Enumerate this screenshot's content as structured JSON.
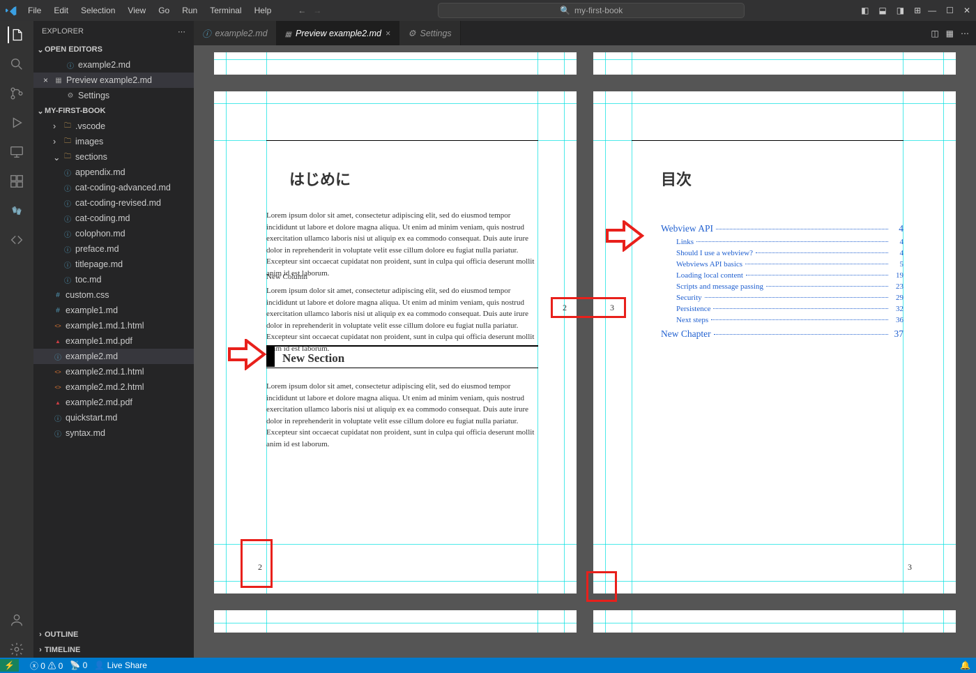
{
  "title": "my-first-book",
  "menu": [
    "File",
    "Edit",
    "Selection",
    "View",
    "Go",
    "Run",
    "Terminal",
    "Help"
  ],
  "sidebar": {
    "title": "EXPLORER",
    "open_editors_label": "OPEN EDITORS",
    "open_editors": [
      {
        "icon": "info",
        "label": "example2.md"
      },
      {
        "icon": "prev",
        "label": "Preview example2.md",
        "closable": true
      },
      {
        "icon": "gear",
        "label": "Settings"
      }
    ],
    "project_label": "MY-FIRST-BOOK",
    "tree": [
      {
        "icon": "folder",
        "label": ".vscode",
        "depth": 1,
        "chev": ">"
      },
      {
        "icon": "folder",
        "label": "images",
        "depth": 1,
        "chev": ">"
      },
      {
        "icon": "folder",
        "label": "sections",
        "depth": 1,
        "chev": "v"
      },
      {
        "icon": "info",
        "label": "appendix.md",
        "depth": 2
      },
      {
        "icon": "info",
        "label": "cat-coding-advanced.md",
        "depth": 2
      },
      {
        "icon": "info",
        "label": "cat-coding-revised.md",
        "depth": 2
      },
      {
        "icon": "info",
        "label": "cat-coding.md",
        "depth": 2
      },
      {
        "icon": "info",
        "label": "colophon.md",
        "depth": 2
      },
      {
        "icon": "info",
        "label": "preface.md",
        "depth": 2
      },
      {
        "icon": "info",
        "label": "titlepage.md",
        "depth": 2
      },
      {
        "icon": "info",
        "label": "toc.md",
        "depth": 2
      },
      {
        "icon": "css",
        "label": "custom.css",
        "depth": 1
      },
      {
        "icon": "md",
        "label": "example1.md",
        "depth": 1
      },
      {
        "icon": "html",
        "label": "example1.md.1.html",
        "depth": 1
      },
      {
        "icon": "pdf",
        "label": "example1.md.pdf",
        "depth": 1
      },
      {
        "icon": "info",
        "label": "example2.md",
        "depth": 1,
        "selected": true
      },
      {
        "icon": "html",
        "label": "example2.md.1.html",
        "depth": 1
      },
      {
        "icon": "html",
        "label": "example2.md.2.html",
        "depth": 1
      },
      {
        "icon": "pdf",
        "label": "example2.md.pdf",
        "depth": 1
      },
      {
        "icon": "info",
        "label": "quickstart.md",
        "depth": 1
      },
      {
        "icon": "info",
        "label": "syntax.md",
        "depth": 1
      }
    ],
    "outline_label": "OUTLINE",
    "timeline_label": "TIMELINE"
  },
  "tabs": [
    {
      "icon": "info",
      "label": "example2.md",
      "active": false
    },
    {
      "icon": "prev",
      "label": "Preview example2.md",
      "active": true,
      "close": true
    },
    {
      "icon": "gear",
      "label": "Settings",
      "active": false
    }
  ],
  "page_left": {
    "h1": "はじめに",
    "para1": "Lorem ipsum dolor sit amet, consectetur adipiscing elit, sed do eiusmod tempor incididunt ut labore et dolore magna aliqua. Ut enim ad minim veniam, quis nostrud exercitation ullamco laboris nisi ut aliquip ex ea commodo consequat. Duis aute irure dolor in reprehenderit in voluptate velit esse cillum dolore eu fugiat nulla pariatur. Excepteur sint occaecat cupidatat non proident, sunt in culpa qui officia deserunt mollit anim id est laborum.",
    "newcol": "New Column",
    "para2": "Lorem ipsum dolor sit amet, consectetur adipiscing elit, sed do eiusmod tempor incididunt ut labore et dolore magna aliqua. Ut enim ad minim veniam, quis nostrud exercitation ullamco laboris nisi ut aliquip ex ea commodo consequat. Duis aute irure dolor in reprehenderit in voluptate velit esse cillum dolore eu fugiat nulla pariatur. Excepteur sint occaecat cupidatat non proident, sunt in culpa qui officia deserunt mollit anim id est laborum.",
    "section": "New Section",
    "para3": "Lorem ipsum dolor sit amet, consectetur adipiscing elit, sed do eiusmod tempor incididunt ut labore et dolore magna aliqua. Ut enim ad minim veniam, quis nostrud exercitation ullamco laboris nisi ut aliquip ex ea commodo consequat. Duis aute irure dolor in reprehenderit in voluptate velit esse cillum dolore eu fugiat nulla pariatur. Excepteur sint occaecat cupidatat non proident, sunt in culpa qui officia deserunt mollit anim id est laborum.",
    "pagenum": "2"
  },
  "page_right": {
    "h1": "目次",
    "toc": [
      {
        "label": "Webview API",
        "page": "4",
        "chapter": true
      },
      {
        "label": "Links",
        "page": "4"
      },
      {
        "label": "Should I use a webview?",
        "page": "4"
      },
      {
        "label": "Webviews API basics",
        "page": "5"
      },
      {
        "label": "Loading local content",
        "page": "19"
      },
      {
        "label": "Scripts and message passing",
        "page": "23"
      },
      {
        "label": "Security",
        "page": "29"
      },
      {
        "label": "Persistence",
        "page": "32"
      },
      {
        "label": "Next steps",
        "page": "36"
      },
      {
        "label": "New Chapter",
        "page": "37",
        "chapter": true
      }
    ],
    "pagenum": "3"
  },
  "center_nums": {
    "left": "2",
    "right": "3"
  },
  "status": {
    "errors": "0",
    "warnings": "0",
    "ports": "0",
    "live": "Live Share"
  }
}
